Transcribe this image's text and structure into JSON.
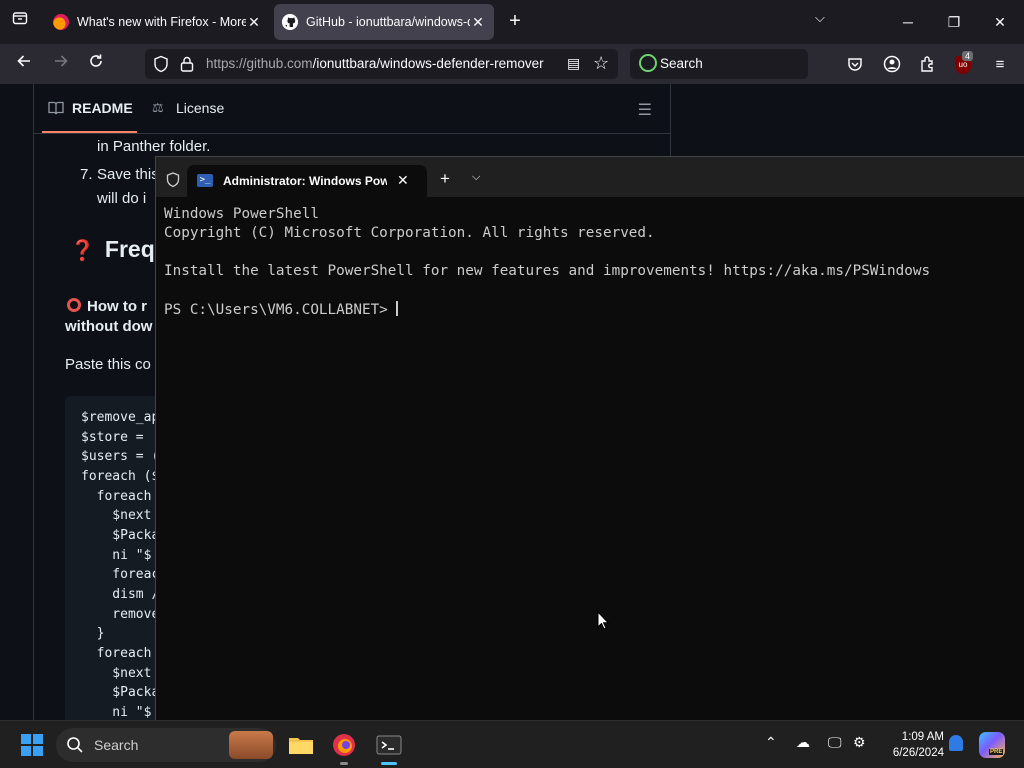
{
  "browser": {
    "tabs": [
      {
        "title": "What's new with Firefox - More",
        "icon": "firefox-icon"
      },
      {
        "title": "GitHub - ionuttbara/windows-defender-remover",
        "icon": "github-icon",
        "active": true
      }
    ],
    "url_domain": "https://github.com",
    "url_path": "/ionuttbara/windows-defender-remover",
    "search_placeholder": "Search",
    "ublock_badge": "4"
  },
  "github": {
    "tabs": {
      "readme": "README",
      "license": "License"
    },
    "lines": {
      "panther": "in Panther folder.",
      "step7_num": "7.",
      "step7_text": "Save this",
      "step7_cont": "will do i",
      "heading": "Frequ",
      "q_bold1": "How to r",
      "q_bold2": "without dow",
      "paste": "Paste this co"
    },
    "code": [
      "$remove_ap",
      "$store = ",
      "$users = (",
      "foreach ($",
      "  foreach",
      "    $next",
      "    $Packa",
      "    ni \"$",
      "    foreac",
      "    dism /",
      "    remove",
      "  }",
      "  foreach",
      "    $next",
      "    $Packa",
      "    ni \"$"
    ]
  },
  "terminal": {
    "tab_title": "Administrator: Windows PowerShell",
    "lines": [
      "Windows PowerShell",
      "Copyright (C) Microsoft Corporation. All rights reserved.",
      "",
      "Install the latest PowerShell for new features and improvements! https://aka.ms/PSWindows",
      "",
      "PS C:\\Users\\VM6.COLLABNET> "
    ]
  },
  "taskbar": {
    "search_label": "Search",
    "time": "1:09 AM",
    "date": "6/26/2024",
    "apps": [
      "file-explorer-icon",
      "firefox-icon",
      "terminal-icon"
    ],
    "copilot_badge": "PRE"
  }
}
